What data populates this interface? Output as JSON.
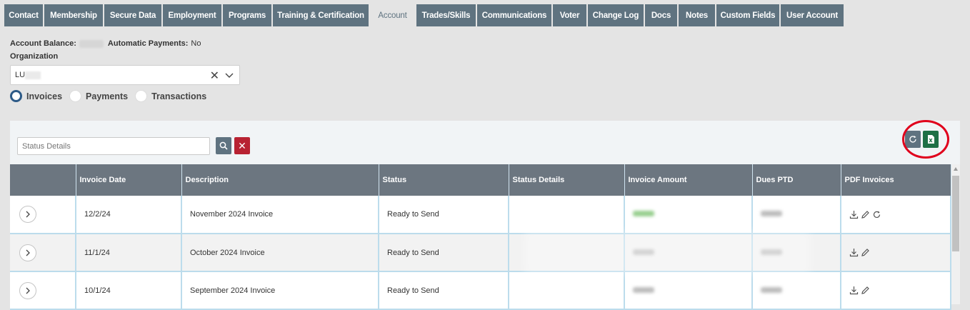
{
  "tabs": [
    {
      "label": "Contact",
      "active": false
    },
    {
      "label": "Membership",
      "active": false
    },
    {
      "label": "Secure Data",
      "active": false
    },
    {
      "label": "Employment",
      "active": false
    },
    {
      "label": "Programs",
      "active": false
    },
    {
      "label": "Training & Certification",
      "active": false
    },
    {
      "label": "Account",
      "active": true
    },
    {
      "label": "Trades/Skills",
      "active": false
    },
    {
      "label": "Communications",
      "active": false
    },
    {
      "label": "Voter",
      "active": false
    },
    {
      "label": "Change Log",
      "active": false
    },
    {
      "label": "Docs",
      "active": false
    },
    {
      "label": "Notes",
      "active": false
    },
    {
      "label": "Custom Fields",
      "active": false
    },
    {
      "label": "User Account",
      "active": false
    }
  ],
  "account": {
    "balance_label": "Account Balance:",
    "auto_pay_label": "Automatic Payments:",
    "auto_pay_value": "No"
  },
  "organization": {
    "label": "Organization",
    "value": "LU"
  },
  "view_options": [
    {
      "label": "Invoices",
      "selected": true
    },
    {
      "label": "Payments",
      "selected": false
    },
    {
      "label": "Transactions",
      "selected": false
    }
  ],
  "search": {
    "placeholder": "Status Details"
  },
  "table": {
    "columns": [
      "",
      "Invoice Date",
      "Description",
      "Status",
      "Status Details",
      "Invoice Amount",
      "Dues PTD",
      "PDF Invoices"
    ],
    "rows": [
      {
        "date": "12/2/24",
        "description": "November 2024 Invoice",
        "status": "Ready to Send",
        "status_details": "",
        "actions": [
          "download-icon",
          "edit-icon",
          "regenerate-icon"
        ]
      },
      {
        "date": "11/1/24",
        "description": "October 2024 Invoice",
        "status": "Ready to Send",
        "status_details": "",
        "actions": [
          "download-icon",
          "edit-icon"
        ]
      },
      {
        "date": "10/1/24",
        "description": "September 2024 Invoice",
        "status": "Ready to Send",
        "status_details": "",
        "actions": [
          "download-icon",
          "edit-icon"
        ]
      }
    ]
  },
  "colors": {
    "tab_bg": "#5f7380",
    "header_bg": "#6c7680",
    "export_green": "#1e7046",
    "clear_red": "#b82232",
    "highlight_red": "#e0001c",
    "radio_selected": "#2d5a87"
  }
}
